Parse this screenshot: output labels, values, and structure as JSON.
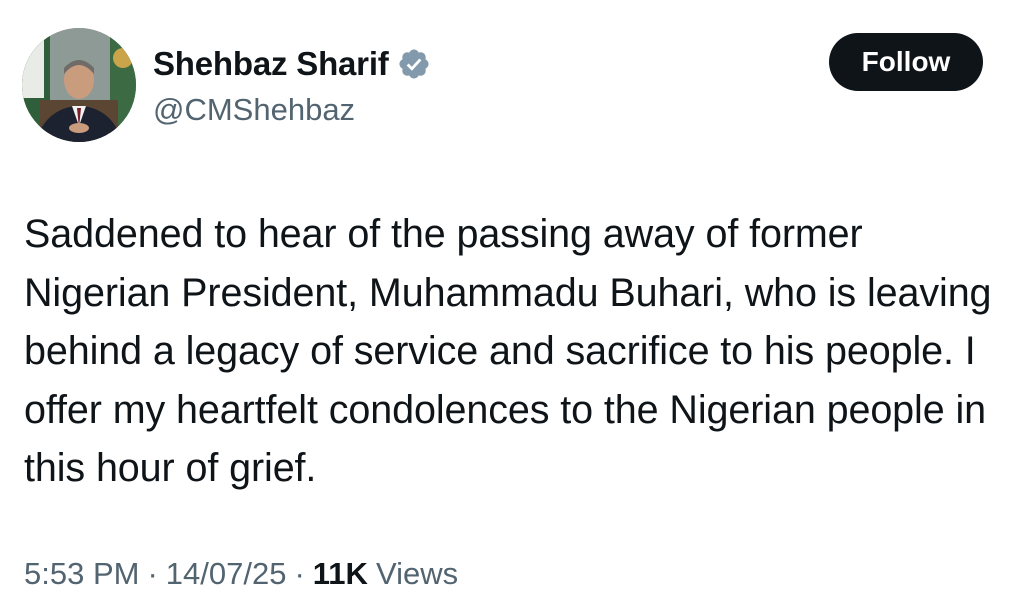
{
  "author": {
    "display_name": "Shehbaz Sharif",
    "handle": "@CMShehbaz",
    "verified_icon": "verified-badge-icon",
    "avatar_icon": "avatar"
  },
  "follow_button": {
    "label": "Follow"
  },
  "tweet": {
    "text": "Saddened to hear of the passing away of former Nigerian President, Muhammadu Buhari, who is leaving behind a legacy of service and sacrifice to his people. I offer my heartfelt condolences to the Nigerian people in this hour of grief."
  },
  "meta": {
    "time": "5:53 PM",
    "separator": "·",
    "date": "14/07/25",
    "views_count": "11K",
    "views_label": "Views"
  },
  "colors": {
    "text_primary": "#0f1419",
    "text_secondary": "#536471",
    "button_bg": "#0f1419",
    "verified_badge": "#829aab"
  }
}
